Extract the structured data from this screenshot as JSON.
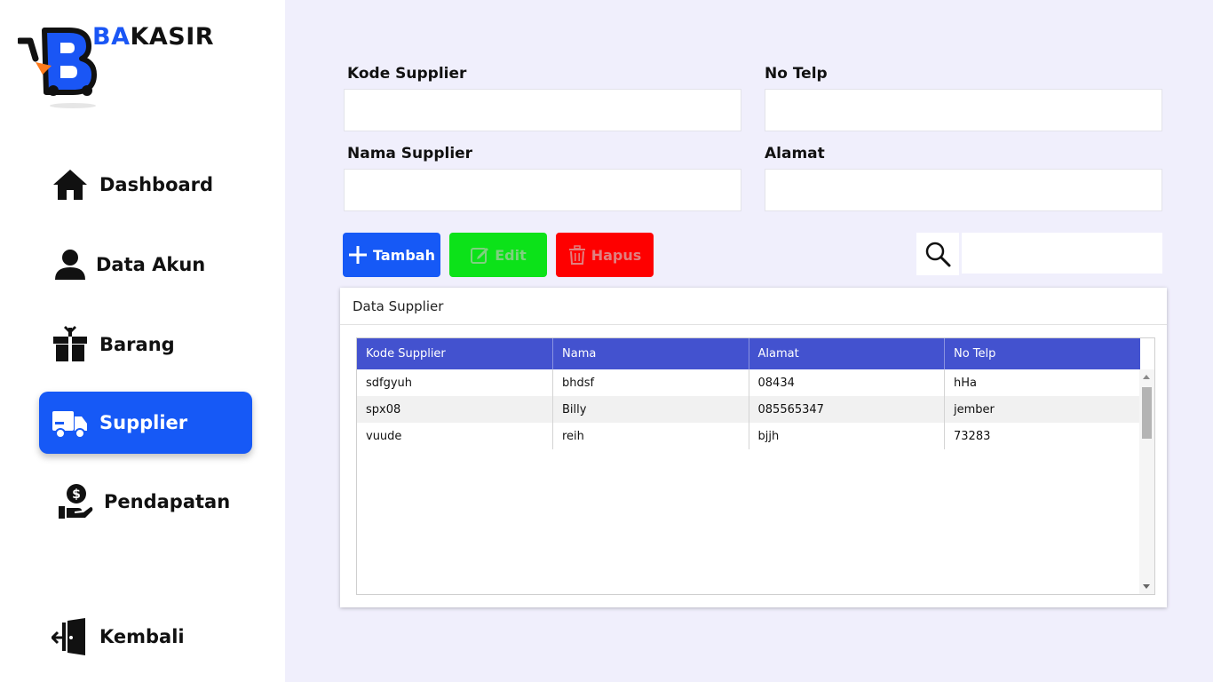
{
  "brand": {
    "prefix": "BA",
    "suffix": "KASIR"
  },
  "nav": [
    {
      "label": "Dashboard",
      "icon": "home-icon",
      "active": false
    },
    {
      "label": "Data Akun",
      "icon": "user-icon",
      "active": false
    },
    {
      "label": "Barang",
      "icon": "box-icon",
      "active": false
    },
    {
      "label": "Supplier",
      "icon": "truck-icon",
      "active": true
    },
    {
      "label": "Pendapatan",
      "icon": "income-icon",
      "active": false
    }
  ],
  "back": {
    "label": "Kembali",
    "icon": "exit-door-icon"
  },
  "form": {
    "kode_label": "Kode Supplier",
    "kode_value": "",
    "telp_label": "No Telp",
    "telp_value": "",
    "nama_label": "Nama Supplier",
    "nama_value": "",
    "alamat_label": "Alamat",
    "alamat_value": ""
  },
  "actions": {
    "add": "Tambah",
    "edit": "Edit",
    "delete": "Hapus"
  },
  "search": {
    "value": "",
    "icon": "search-icon"
  },
  "panel": {
    "title": "Data Supplier"
  },
  "table": {
    "columns": [
      "Kode Supplier",
      "Nama",
      "Alamat",
      "No Telp"
    ],
    "rows": [
      [
        "sdfgyuh",
        "bhdsf",
        "08434",
        "hHa"
      ],
      [
        "spx08",
        "Billy",
        "085565347",
        "jember"
      ],
      [
        "vuude",
        "reih",
        "bjjh",
        "73283"
      ]
    ]
  },
  "colors": {
    "accent": "#1659f6",
    "edit": "#0ce219",
    "delete": "#fe0000",
    "table_header": "#4352cf",
    "background": "#f0effc"
  }
}
